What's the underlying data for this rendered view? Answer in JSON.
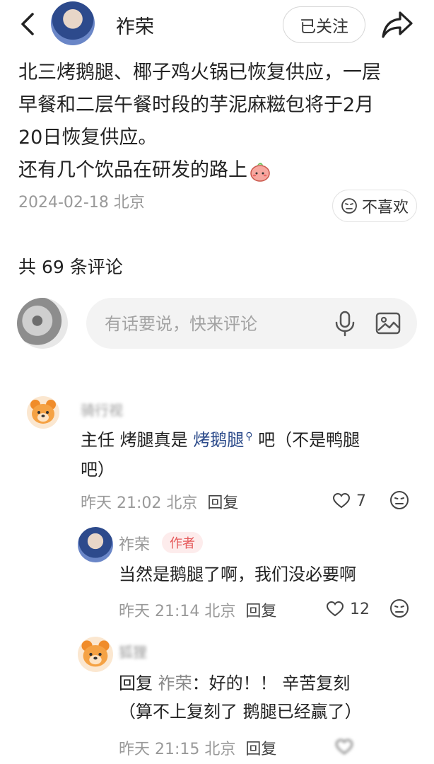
{
  "header": {
    "author_name": "祚荣",
    "follow_label": "已关注"
  },
  "post": {
    "line1": "北三烤鹅腿、椰子鸡火锅已恢复供应，一层",
    "line2": "早餐和二层午餐时段的芋泥麻糍包将于2月",
    "line3": "20日恢复供应。",
    "line4": "还有几个饮品在研发的路上",
    "meta": "2024-02-18 北京",
    "dislike_label": "不喜欢"
  },
  "comments_header": {
    "count_text": "共 69 条评论"
  },
  "comment_input": {
    "placeholder": "有话要说，快来评论"
  },
  "comments": [
    {
      "name": "骑行视",
      "text_before": "主任 烤腿真是 ",
      "keyword": "烤鹅腿",
      "text_after": " 吧（不是鸭腿",
      "text_line2": "吧）",
      "time": "昨天 21:02 北京",
      "reply_label": "回复",
      "likes": "7"
    },
    {
      "name": "祚荣",
      "tag": "作者",
      "text": "当然是鹅腿了啊，我们没必要啊",
      "time": "昨天 21:14 北京",
      "reply_label": "回复",
      "likes": "12"
    },
    {
      "name": "狐狸",
      "reply_prefix": "回复 ",
      "reply_to": "祚荣",
      "text_line1": "：好的！！ 辛苦复刻",
      "text_line2": "（算不上复刻了 鹅腿已经赢了）",
      "time": "昨天 21:15 北京",
      "reply_label": "回复"
    }
  ],
  "colors": {
    "keyword": "#2b4a8a",
    "author_tag_bg": "#fdecec",
    "author_tag_text": "#e5595a",
    "meta": "#999999"
  },
  "icons": [
    "back-arrow-icon",
    "share-icon",
    "dislike-face-icon",
    "mic-icon",
    "image-icon",
    "heart-icon",
    "search-keyword-icon",
    "peach-emoji-icon",
    "bear-avatar-icon"
  ]
}
